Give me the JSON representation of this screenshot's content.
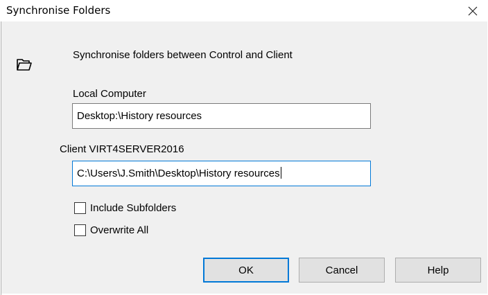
{
  "window": {
    "title": "Synchronise Folders",
    "close_icon": "close-icon"
  },
  "dialog": {
    "icon": "folder-open-icon",
    "heading": "Synchronise folders between Control and Client",
    "local": {
      "label": "Local Computer",
      "value": "Desktop:\\History resources"
    },
    "client": {
      "label": "Client VIRT4SERVER2016",
      "value": "C:\\Users\\J.Smith\\Desktop\\History resources"
    },
    "options": [
      {
        "label": "Include Subfolders",
        "checked": false
      },
      {
        "label": "Overwrite All",
        "checked": false
      }
    ]
  },
  "buttons": {
    "ok": "OK",
    "cancel": "Cancel",
    "help": "Help"
  },
  "colors": {
    "accent": "#0078d7",
    "dialog_bg": "#f0f0f0",
    "button_bg": "#e1e1e1"
  }
}
